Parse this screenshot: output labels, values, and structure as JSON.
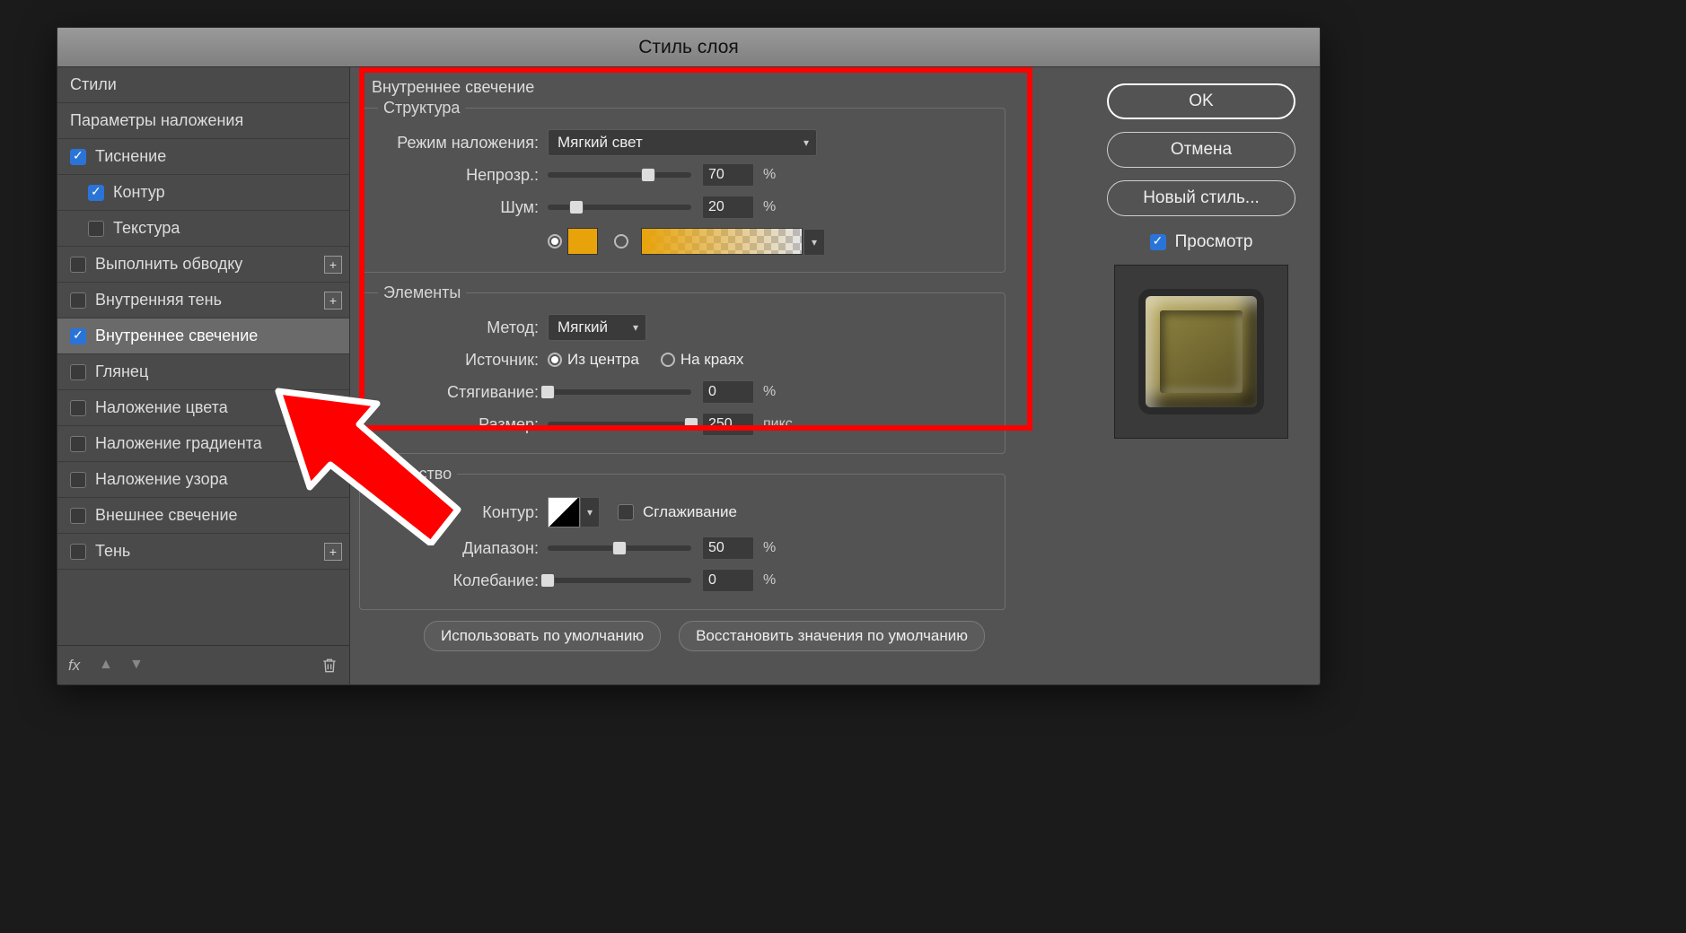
{
  "dialog": {
    "title": "Стиль слоя"
  },
  "sidebar": {
    "styles_header": "Стили",
    "blending_options": "Параметры наложения",
    "items": [
      {
        "label": "Тиснение",
        "checked": true,
        "plus": false,
        "active": false,
        "sub": false
      },
      {
        "label": "Контур",
        "checked": true,
        "plus": false,
        "active": false,
        "sub": true
      },
      {
        "label": "Текстура",
        "checked": false,
        "plus": false,
        "active": false,
        "sub": true
      },
      {
        "label": "Выполнить обводку",
        "checked": false,
        "plus": true,
        "active": false,
        "sub": false
      },
      {
        "label": "Внутренняя тень",
        "checked": false,
        "plus": true,
        "active": false,
        "sub": false
      },
      {
        "label": "Внутреннее свечение",
        "checked": true,
        "plus": false,
        "active": true,
        "sub": false
      },
      {
        "label": "Глянец",
        "checked": false,
        "plus": false,
        "active": false,
        "sub": false
      },
      {
        "label": "Наложение цвета",
        "checked": false,
        "plus": true,
        "active": false,
        "sub": false
      },
      {
        "label": "Наложение градиента",
        "checked": false,
        "plus": true,
        "active": false,
        "sub": false
      },
      {
        "label": "Наложение узора",
        "checked": false,
        "plus": false,
        "active": false,
        "sub": false
      },
      {
        "label": "Внешнее свечение",
        "checked": false,
        "plus": false,
        "active": false,
        "sub": false
      },
      {
        "label": "Тень",
        "checked": false,
        "plus": true,
        "active": false,
        "sub": false
      }
    ]
  },
  "panel": {
    "title": "Внутреннее свечение",
    "structure": {
      "legend": "Структура",
      "blend_mode_label": "Режим наложения:",
      "blend_mode_value": "Мягкий свет",
      "opacity_label": "Непрозр.:",
      "opacity_value": "70",
      "opacity_unit": "%",
      "opacity_pct": 70,
      "noise_label": "Шум:",
      "noise_value": "20",
      "noise_unit": "%",
      "noise_pct": 20,
      "color_hex": "#e8a30a",
      "color_radio_color": true,
      "color_radio_gradient": false
    },
    "elements": {
      "legend": "Элементы",
      "technique_label": "Метод:",
      "technique_value": "Мягкий",
      "source_label": "Источник:",
      "source_center": "Из центра",
      "source_edge": "На краях",
      "source_selected": "center",
      "choke_label": "Стягивание:",
      "choke_value": "0",
      "choke_unit": "%",
      "choke_pct": 0,
      "size_label": "Размер:",
      "size_value": "250",
      "size_unit": "пикс.",
      "size_pct": 100
    },
    "quality": {
      "legend": "Качество",
      "contour_label": "Контур:",
      "antialias_label": "Сглаживание",
      "antialias_checked": false,
      "range_label": "Диапазон:",
      "range_value": "50",
      "range_unit": "%",
      "range_pct": 50,
      "jitter_label": "Колебание:",
      "jitter_value": "0",
      "jitter_unit": "%",
      "jitter_pct": 0
    },
    "buttons": {
      "make_default": "Использовать по умолчанию",
      "reset_default": "Восстановить значения по умолчанию"
    }
  },
  "right": {
    "ok": "OK",
    "cancel": "Отмена",
    "new_style": "Новый стиль...",
    "preview": "Просмотр",
    "preview_checked": true
  }
}
